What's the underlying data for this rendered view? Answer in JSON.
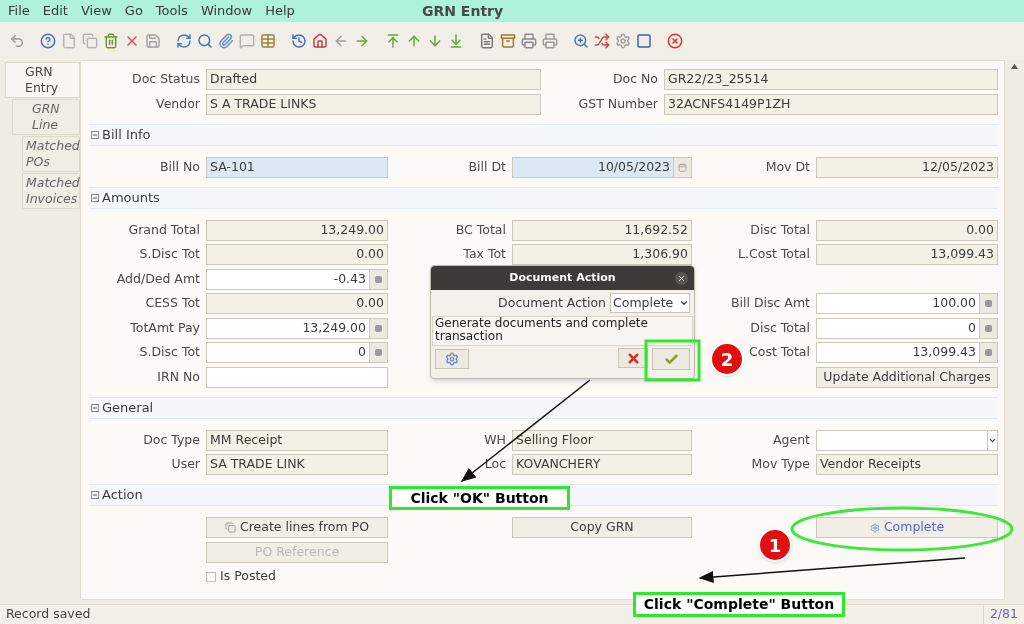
{
  "window": {
    "title": "GRN Entry"
  },
  "menu": [
    "File",
    "Edit",
    "View",
    "Go",
    "Tools",
    "Window",
    "Help"
  ],
  "tabs": [
    {
      "label": "GRN Entry",
      "selected": true
    },
    {
      "label": "GRN Line",
      "selected": false
    },
    {
      "label": "Matched POs",
      "selected": false
    },
    {
      "label": "Matched Invoices",
      "selected": false
    }
  ],
  "header_fields": [
    {
      "label": "Doc Status",
      "value": "Drafted"
    },
    {
      "label": "Doc No",
      "value": "GR22/23_25514"
    },
    {
      "label": "Vendor",
      "value": "S A TRADE LINKS"
    },
    {
      "label": "GST Number",
      "value": "32ACNFS4149P1ZH"
    }
  ],
  "sections": [
    {
      "title": "Bill Info",
      "expanded": true,
      "rows": [
        {
          "left": {
            "label": "Bill No",
            "value": "SA-101",
            "kind": "text",
            "readonly": false,
            "mandatory": true
          },
          "middle": {
            "label": "Bill Dt",
            "value": "10/05/2023",
            "kind": "date",
            "readonly": false,
            "mandatory": true
          },
          "right": {
            "label": "Mov Dt",
            "value": "12/05/2023",
            "kind": "date",
            "readonly": true
          }
        }
      ]
    },
    {
      "title": "Amounts",
      "expanded": true,
      "rows": [
        {
          "left": {
            "label": "Grand Total",
            "value": "13,249.00",
            "kind": "number",
            "readonly": true
          },
          "middle": {
            "label": "BC Total",
            "value": "11,692.52",
            "kind": "number",
            "readonly": true
          },
          "right": {
            "label": "Disc Total",
            "value": "0.00",
            "kind": "number",
            "readonly": true
          }
        },
        {
          "left": {
            "label": "S.Disc Tot",
            "value": "0.00",
            "kind": "number",
            "readonly": true
          },
          "middle": {
            "label": "Tax Tot",
            "value": "1,306.90",
            "kind": "number",
            "readonly": true
          },
          "right": {
            "label": "L.Cost Total",
            "value": "13,099.43",
            "kind": "number",
            "readonly": true
          }
        },
        {
          "left": {
            "label": "Add/Ded Amt",
            "value": "-0.43",
            "kind": "number",
            "readonly": false,
            "mandatory": false
          }
        },
        {
          "left": {
            "label": "CESS Tot",
            "value": "0.00",
            "kind": "number",
            "readonly": true
          },
          "right": {
            "label": "Bill Disc Amt",
            "value": "100.00",
            "kind": "number",
            "readonly": false,
            "mandatory": false
          }
        },
        {
          "left": {
            "label": "TotAmt Pay",
            "value": "13,249.00",
            "kind": "number",
            "readonly": false,
            "mandatory": false
          },
          "right": {
            "label": "Disc Total",
            "value": "0",
            "kind": "number",
            "readonly": false,
            "mandatory": false
          }
        },
        {
          "left": {
            "label": "S.Disc Tot",
            "value": "0",
            "kind": "number",
            "readonly": false,
            "mandatory": false
          },
          "right": {
            "label": "Cost Total",
            "value": "13,099.43",
            "kind": "number",
            "readonly": false,
            "mandatory": false
          }
        },
        {
          "left": {
            "label": "IRN No",
            "kind": "text",
            "readonly": false,
            "mandatory": false
          },
          "right": {
            "label": "Update Additional Charges",
            "kind": "button",
            "disabled": false
          }
        }
      ]
    },
    {
      "title": "General",
      "expanded": true,
      "rows": [
        {
          "left": {
            "label": "Doc Type",
            "value": "MM Receipt",
            "kind": "text",
            "readonly": true
          },
          "middle": {
            "label": "WH",
            "value": "Selling Floor",
            "kind": "text",
            "readonly": true
          },
          "right": {
            "label": "Agent",
            "kind": "select",
            "readonly": false,
            "mandatory": false
          }
        },
        {
          "left": {
            "label": "User",
            "value": "SA TRADE LINK",
            "kind": "text",
            "readonly": true
          },
          "middle": {
            "label": "Loc",
            "value": "KOVANCHERY",
            "kind": "text",
            "readonly": true
          },
          "right": {
            "label": "Mov Type",
            "value": "Vendor Receipts",
            "kind": "text",
            "readonly": true
          }
        }
      ]
    },
    {
      "title": "Action",
      "expanded": true,
      "rows": [
        {
          "left": {
            "label": "Create lines from PO",
            "kind": "process_button",
            "disabled": false,
            "highlighted": false
          },
          "middle": {
            "label": "Copy GRN",
            "kind": "button",
            "disabled": false
          },
          "right": {
            "label": "Complete",
            "kind": "process_button",
            "disabled": false,
            "highlighted": true
          }
        },
        {
          "left": {
            "label": "PO Reference",
            "kind": "button",
            "disabled": true
          }
        },
        {
          "left": {
            "label": "Is Posted",
            "kind": "checkbox",
            "checked": false
          }
        }
      ]
    }
  ],
  "dialog": {
    "title": "Document Action",
    "action_label": "Document Action",
    "action_value": "Complete",
    "description": "Generate documents and complete transaction"
  },
  "annotations": {
    "callouts": [
      "Click \"OK\" Button",
      "Click \"Complete\" Button"
    ],
    "markers": [
      "1",
      "2"
    ]
  },
  "status_bar": {
    "message": "Record saved",
    "count": "2/81"
  }
}
